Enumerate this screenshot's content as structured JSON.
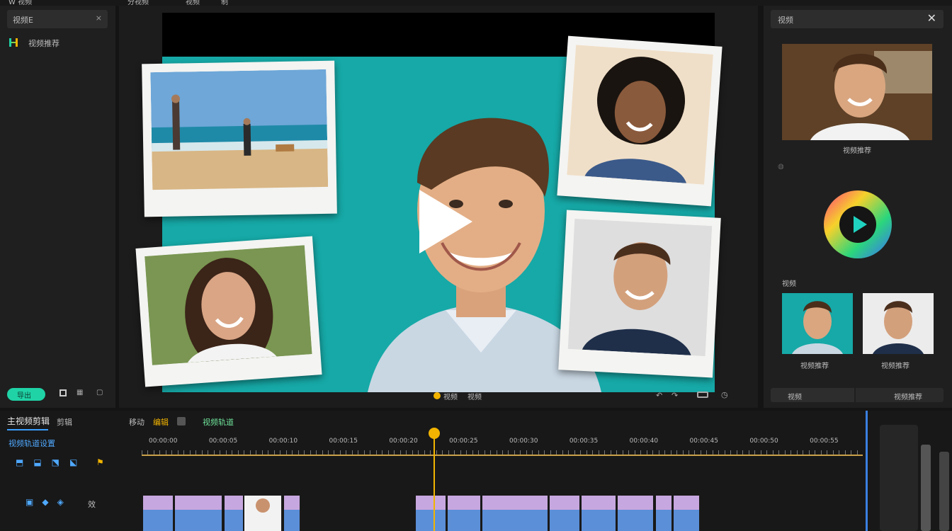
{
  "app": {
    "menu_left": "W 视频",
    "menu_mid": "分视频",
    "menu_mid2": "视频",
    "menu_mid3": "制"
  },
  "left_panel": {
    "dropdown_label": "视频E",
    "item_label": "视频推荐",
    "export_button": "导出",
    "icons": [
      "image-icon",
      "grid-icon",
      "crop-icon"
    ]
  },
  "preview": {
    "caption_left": "视频",
    "caption_right": "视频",
    "play_icon": "play-icon"
  },
  "right_panel": {
    "header_title": "视频",
    "profile_caption": "视频推荐",
    "section_label": "视频",
    "thumb1_caption": "视频推荐",
    "thumb2_caption": "视频推荐",
    "tab_left": "视频",
    "tab_right": "视频推荐"
  },
  "timeline": {
    "tab_active": "主视频剪辑",
    "tab2": "剪辑",
    "tool_label1": "移动",
    "tool_label2": "编辑",
    "tool_label3": "视频轨道",
    "track_title": "视频轨道设置",
    "ruler_labels": [
      "00:00:00",
      "00:00:05",
      "00:00:10",
      "00:00:15",
      "00:00:20",
      "00:00:25",
      "00:00:30",
      "00:00:35",
      "00:00:40",
      "00:00:45",
      "00:00:50",
      "00:00:55"
    ],
    "track_side_label": "效"
  },
  "colors": {
    "accent": "#1fd3a6",
    "playhead": "#f2b400",
    "canvas": "#16a9a7",
    "clip_top": "#c7a7df",
    "clip_bottom": "#5b8fd8"
  }
}
